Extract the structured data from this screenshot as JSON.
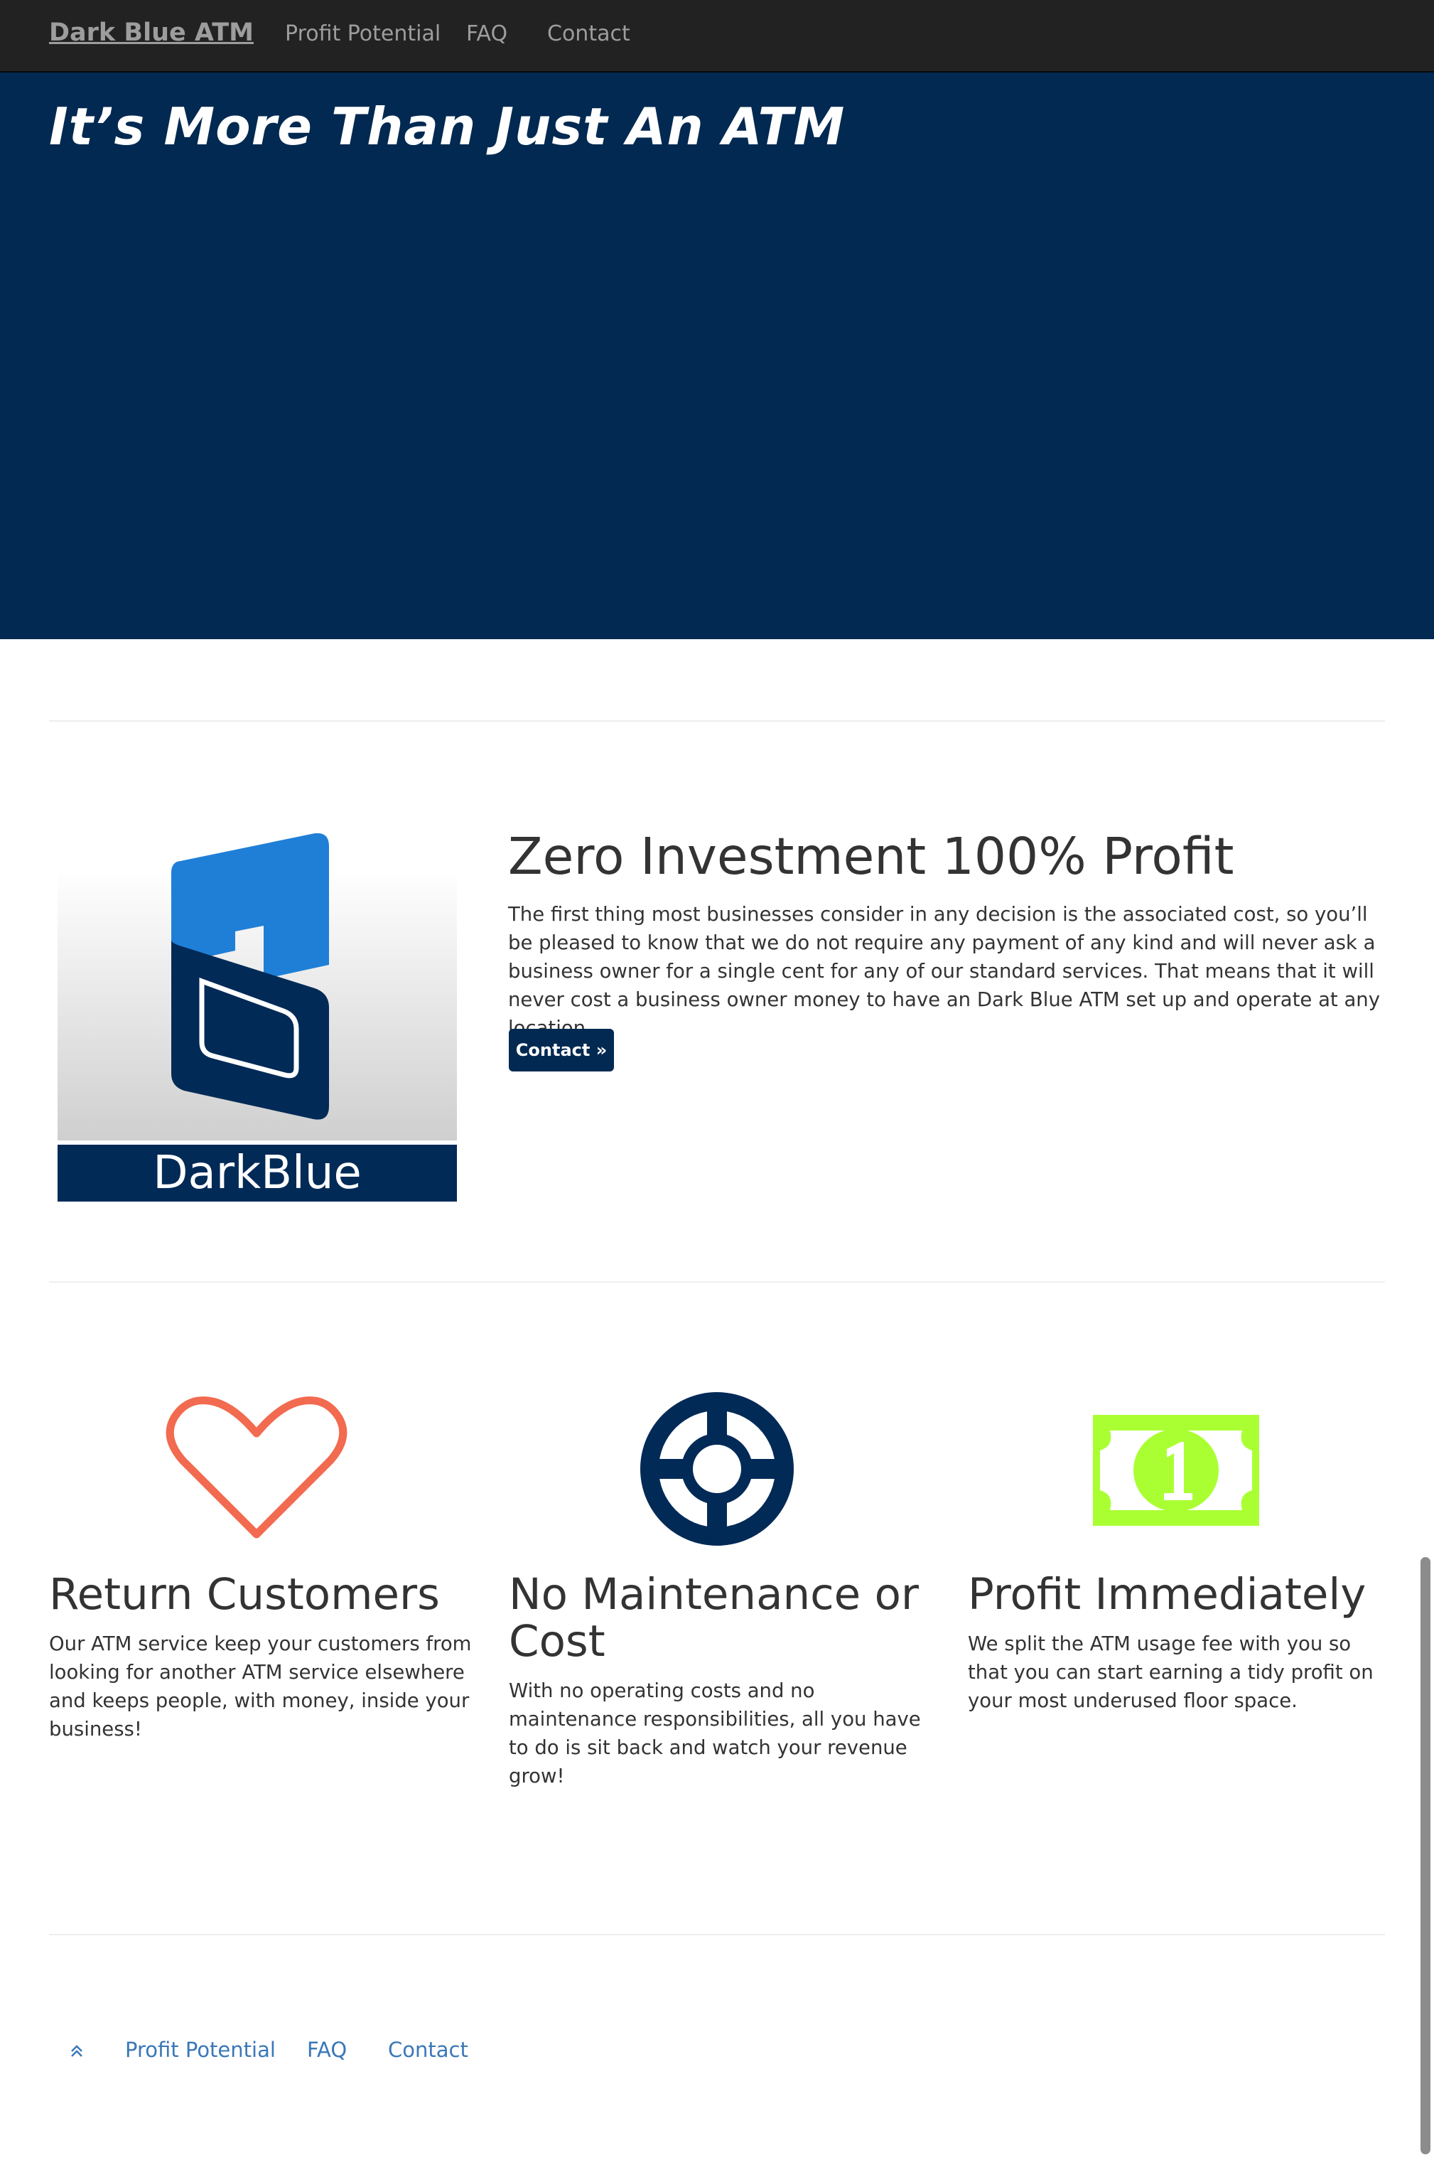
{
  "nav": {
    "brand": "Dark Blue ATM",
    "links": [
      "Profit Potential",
      "FAQ",
      "Contact"
    ]
  },
  "hero": {
    "title": "It’s More Than Just An ATM"
  },
  "feature": {
    "logo_text": "DarkBlue",
    "heading": "Zero Investment 100% Profit",
    "text": "The first thing most businesses consider in any decision is the associated cost, so you’ll be pleased to know that we do not require any payment of any kind and will never ask a business owner for a single cent for any of our standard services. That means that it will never cost a business owner money to have an Dark Blue ATM set up and operate at any location.",
    "button_label": "Contact »"
  },
  "columns": [
    {
      "icon": "heart-icon",
      "title": "Return Customers",
      "text": "Our ATM service keep your customers from looking for another ATM service elsewhere and keeps people, with money, inside your business!"
    },
    {
      "icon": "lifebuoy-icon",
      "title": "No Maintenance or Cost",
      "text": "With no operating costs and no maintenance responsibilities, all you have to do is sit back and watch your revenue grow!"
    },
    {
      "icon": "money-bill-icon",
      "title": "Profit Immediately",
      "text": "We split the ATM usage fee with you so that you can start earning a tidy profit on your most underused floor space."
    }
  ],
  "footer": {
    "links": [
      "Profit Potential",
      "FAQ",
      "Contact"
    ]
  },
  "colors": {
    "navbar": "#222222",
    "brand_blue": "#012951",
    "heart": "#f26a4f",
    "money": "#aaff33",
    "link": "#3a78b8"
  }
}
